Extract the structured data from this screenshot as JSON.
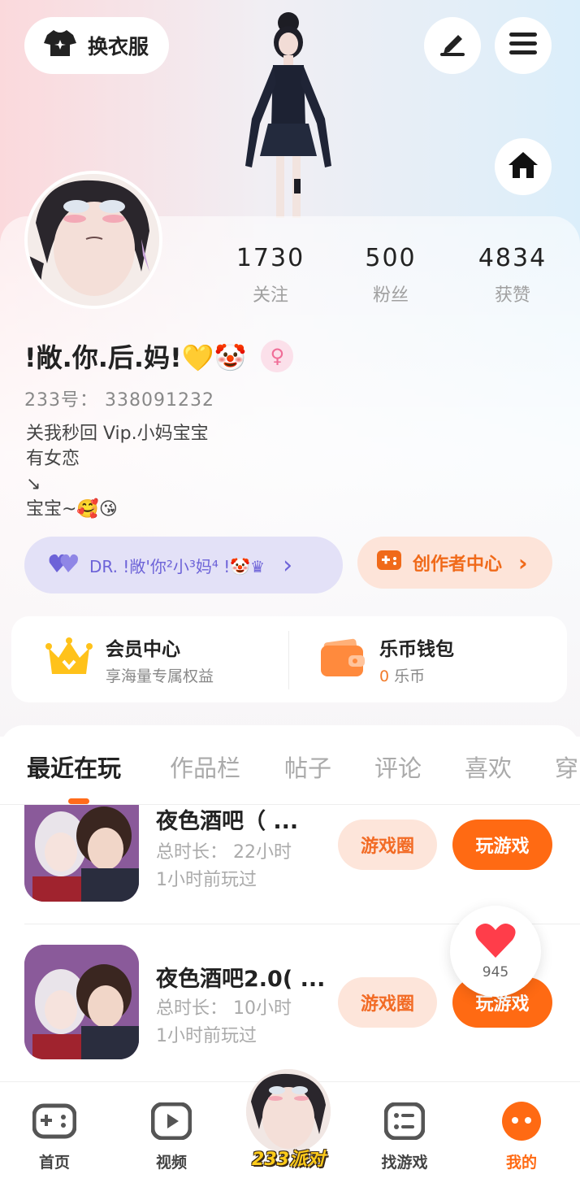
{
  "header": {
    "outfit_label": "换衣服"
  },
  "stats": [
    {
      "value": "1730",
      "label": "关注"
    },
    {
      "value": "500",
      "label": "粉丝"
    },
    {
      "value": "4834",
      "label": "获赞"
    }
  ],
  "profile": {
    "nickname": "!敞.你.后.妈!💛🤡",
    "gender_symbol": "♀",
    "uid": "233号：  338091232",
    "bio": "关我秒回 Vip.小妈宝宝\n有女恋\n↘\n宝宝~🥰😘"
  },
  "club": {
    "label": "DR. !敞'你²小³妈⁴ !🤡♛",
    "chevron": "›"
  },
  "creator": {
    "label": "创作者中心",
    "chevron": "›"
  },
  "wallet": {
    "vip_title": "会员中心",
    "vip_sub": "享海量专属权益",
    "coin_title": "乐币钱包",
    "coin_count": "0",
    "coin_unit": "乐币"
  },
  "tabs": [
    "最近在玩",
    "作品栏",
    "帖子",
    "评论",
    "喜欢",
    "穿"
  ],
  "games": [
    {
      "title": "夜色酒吧（ ...",
      "duration": "总时长： 22小时",
      "last_played": "1小时前玩过",
      "circle_label": "游戏圈",
      "play_label": "玩游戏"
    },
    {
      "title": "夜色酒吧2.0( ...",
      "duration": "总时长： 10小时",
      "last_played": "1小时前玩过",
      "circle_label": "游戏圈",
      "play_label": "玩游戏"
    }
  ],
  "like": {
    "count": "945"
  },
  "nav": {
    "home": "首页",
    "video": "视频",
    "party": "233派对",
    "find": "找游戏",
    "mine": "我的"
  },
  "colors": {
    "accent": "#ff6a13",
    "club_purple": "#6d63d8",
    "club_bg": "#e3e1f7",
    "creator_bg": "#fde4d9"
  }
}
